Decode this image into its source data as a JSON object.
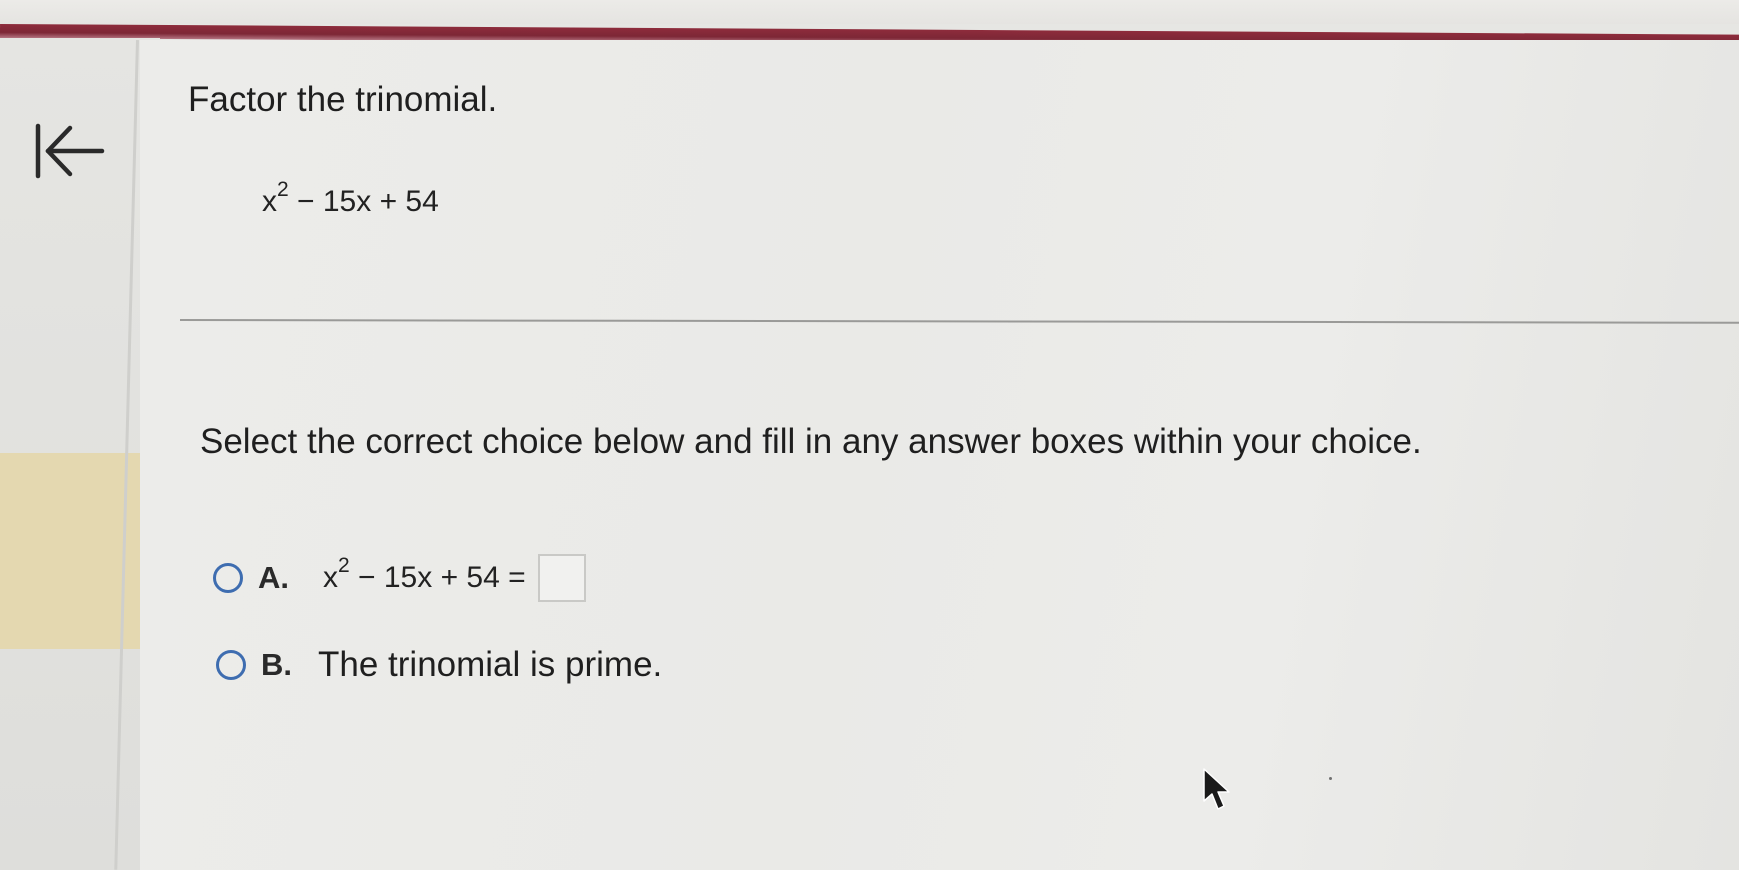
{
  "question": {
    "title": "Factor the trinomial.",
    "expression": {
      "base": "x",
      "exponent": "2",
      "rest": " − 15x + 54"
    }
  },
  "instruction": "Select the correct choice below and fill in any answer boxes within your choice.",
  "choices": [
    {
      "letter": "A.",
      "expression": {
        "base": "x",
        "exponent": "2",
        "rest": " − 15x + 54 ="
      },
      "answer_value": ""
    },
    {
      "letter": "B.",
      "text": "The trinomial is prime."
    }
  ],
  "icons": {
    "back": "back-to-start-icon",
    "pointer": "mouse-pointer-icon"
  },
  "colors": {
    "header_bar": "#7d2736",
    "radio_border": "#3e6db0",
    "highlight": "#e4d8b0"
  }
}
